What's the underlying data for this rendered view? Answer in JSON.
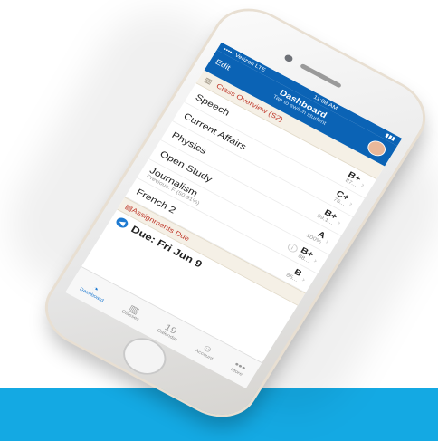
{
  "status_bar": {
    "carrier": "••••• Verizon LTE",
    "time": "11:08 AM",
    "battery": "▮▮▮"
  },
  "nav": {
    "edit_label": "Edit",
    "title": "Dashboard",
    "subtitle": "Tap to switch student"
  },
  "class_overview": {
    "header": "Class Overview (S2)",
    "rows": [
      {
        "name": "Speech",
        "previous": "",
        "grade": "B+",
        "percent": "87..."
      },
      {
        "name": "Current Affairs",
        "previous": "",
        "grade": "C+",
        "percent": "76..."
      },
      {
        "name": "Physics",
        "previous": "",
        "grade": "B+",
        "percent": "89.1..."
      },
      {
        "name": "Open Study",
        "previous": "",
        "grade": "A",
        "percent": "100%"
      },
      {
        "name": "Journalism",
        "previous": "Previous: F (50.91%)",
        "grade": "B+",
        "percent": "88..."
      },
      {
        "name": "French 2",
        "previous": "",
        "grade": "B",
        "percent": "85..."
      }
    ]
  },
  "assignments": {
    "header": "Assignments Due",
    "due_label": "Due: Fri Jun 9"
  },
  "tabs": [
    {
      "label": "Dashboard",
      "icon": "speedometer-icon"
    },
    {
      "label": "Classes",
      "icon": "books-icon"
    },
    {
      "label": "Calendar",
      "icon": "calendar-icon",
      "day": "19"
    },
    {
      "label": "Account",
      "icon": "person-icon"
    },
    {
      "label": "More",
      "icon": "dots-icon"
    }
  ],
  "colors": {
    "brand_blue": "#0b63b5",
    "band_blue": "#14a9e3",
    "accent_red": "#c0392b"
  }
}
